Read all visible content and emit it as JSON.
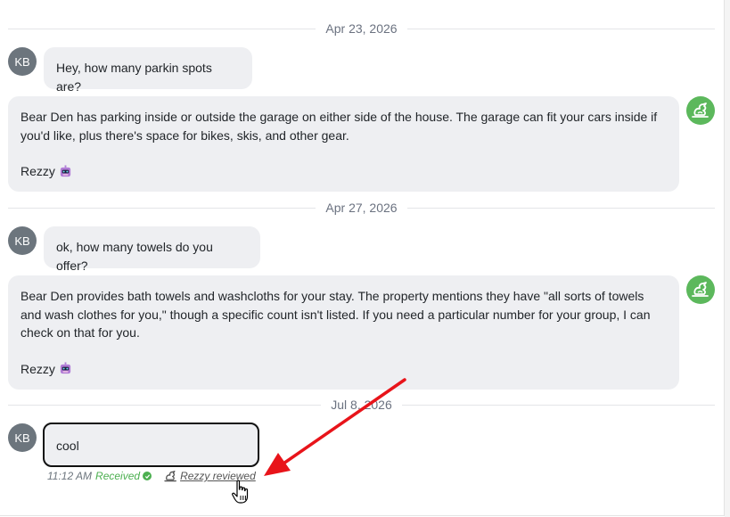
{
  "thread": {
    "groups": [
      {
        "date": "Apr 23, 2026",
        "guest": {
          "initials": "KB",
          "text": "Hey, how many parkin spots are?"
        },
        "bot": {
          "text": "Bear Den has parking inside or outside the garage on either side of the house. The garage can fit your cars inside if you'd like, plus there's space for bikes, skis, and other gear.",
          "signature": "Rezzy"
        }
      },
      {
        "date": "Apr 27, 2026",
        "guest": {
          "initials": "KB",
          "text": "ok, how many towels do you offer?"
        },
        "bot": {
          "text": "Bear Den provides bath towels and washcloths for your stay. The property mentions they have \"all sorts of towels and wash clothes for you,\" though a specific count isn't listed. If you need a particular number for your group, I can check on that for you.",
          "signature": "Rezzy"
        }
      },
      {
        "date": "Jul 8, 2026",
        "guest": {
          "initials": "KB",
          "text": "cool"
        },
        "meta": {
          "time": "11:12 AM",
          "status": "Received",
          "reviewed": "Rezzy reviewed"
        }
      }
    ]
  },
  "colors": {
    "bubble": "#eeeff2",
    "guest_avatar": "#6c757d",
    "bot_avatar": "#5cb85c",
    "received": "#4caf50",
    "annotation_arrow": "#e8141a"
  },
  "icons": {
    "bot_avatar": "dragon-logo-icon",
    "signature": "robot-emoji-icon",
    "status": "check-circle-icon",
    "reviewed": "dragon-logo-icon",
    "cursor": "hand-pointer-icon"
  }
}
